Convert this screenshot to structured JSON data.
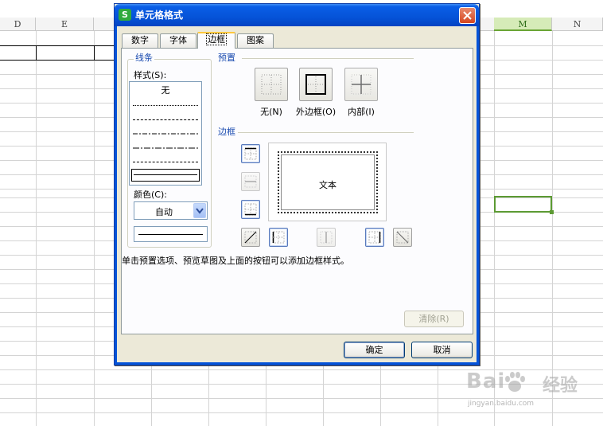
{
  "spreadsheet": {
    "columns": [
      {
        "label": "D",
        "active": false
      },
      {
        "label": "E",
        "active": false
      },
      {
        "label": "M",
        "active": true
      },
      {
        "label": "N",
        "active": false
      }
    ],
    "selection_color": "#5c9a33"
  },
  "dialog": {
    "title": "单元格格式",
    "app_icon": "S",
    "tabs": [
      {
        "label": "数字",
        "active": false
      },
      {
        "label": "字体",
        "active": false
      },
      {
        "label": "边框",
        "active": true
      },
      {
        "label": "图案",
        "active": false
      }
    ],
    "line_group": {
      "title": "线条",
      "style_label": "样式(S):",
      "style_none": "无",
      "color_label": "颜色(C):",
      "color_value": "自动"
    },
    "presets": {
      "title": "预置",
      "items": [
        {
          "label": "无(N)",
          "icon": "no-border-icon",
          "enabled": true
        },
        {
          "label": "外边框(O)",
          "icon": "outline-border-icon",
          "enabled": true
        },
        {
          "label": "内部(I)",
          "icon": "inside-border-icon",
          "enabled": false
        }
      ]
    },
    "border": {
      "title": "边框",
      "preview_text": "文本"
    },
    "hint": "单击预置选项、预览草图及上面的按钮可以添加边框样式。",
    "clear_button": "清除(R)",
    "ok_button": "确定",
    "cancel_button": "取消"
  },
  "watermark": {
    "brand": "Bai",
    "brand_suffix": "经验",
    "url": "jingyan.baidu.com"
  }
}
